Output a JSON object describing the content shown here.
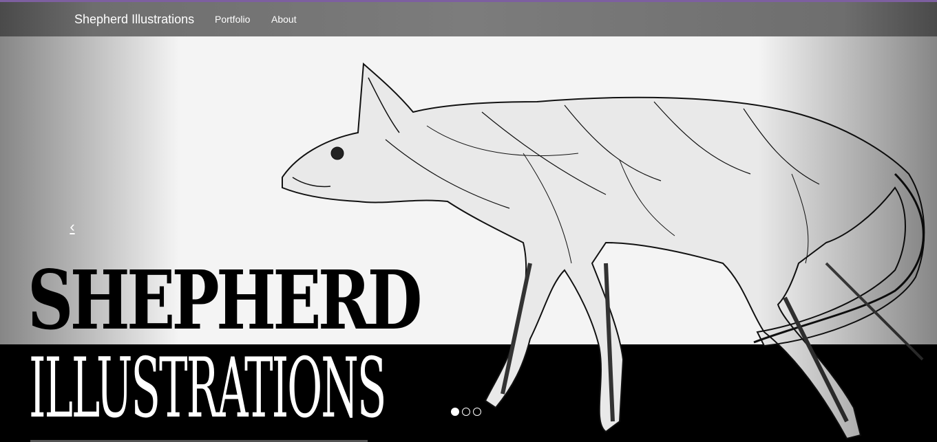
{
  "nav": {
    "brand": "Shepherd Illustrations",
    "links": [
      "Portfolio",
      "About"
    ]
  },
  "carousel": {
    "prev_icon": "chevron-left-icon",
    "prev_glyph": "‹",
    "slide_title_line1": "SHEPHERD",
    "slide_title_line2": "ILLUSTRATIONS",
    "slide_image": "ink drawing of a dog's muscular anatomy",
    "indicator_count": 3,
    "active_index": 0
  },
  "colors": {
    "top_accent": "#7d5fa0",
    "navbar": "#7c7c7c"
  }
}
